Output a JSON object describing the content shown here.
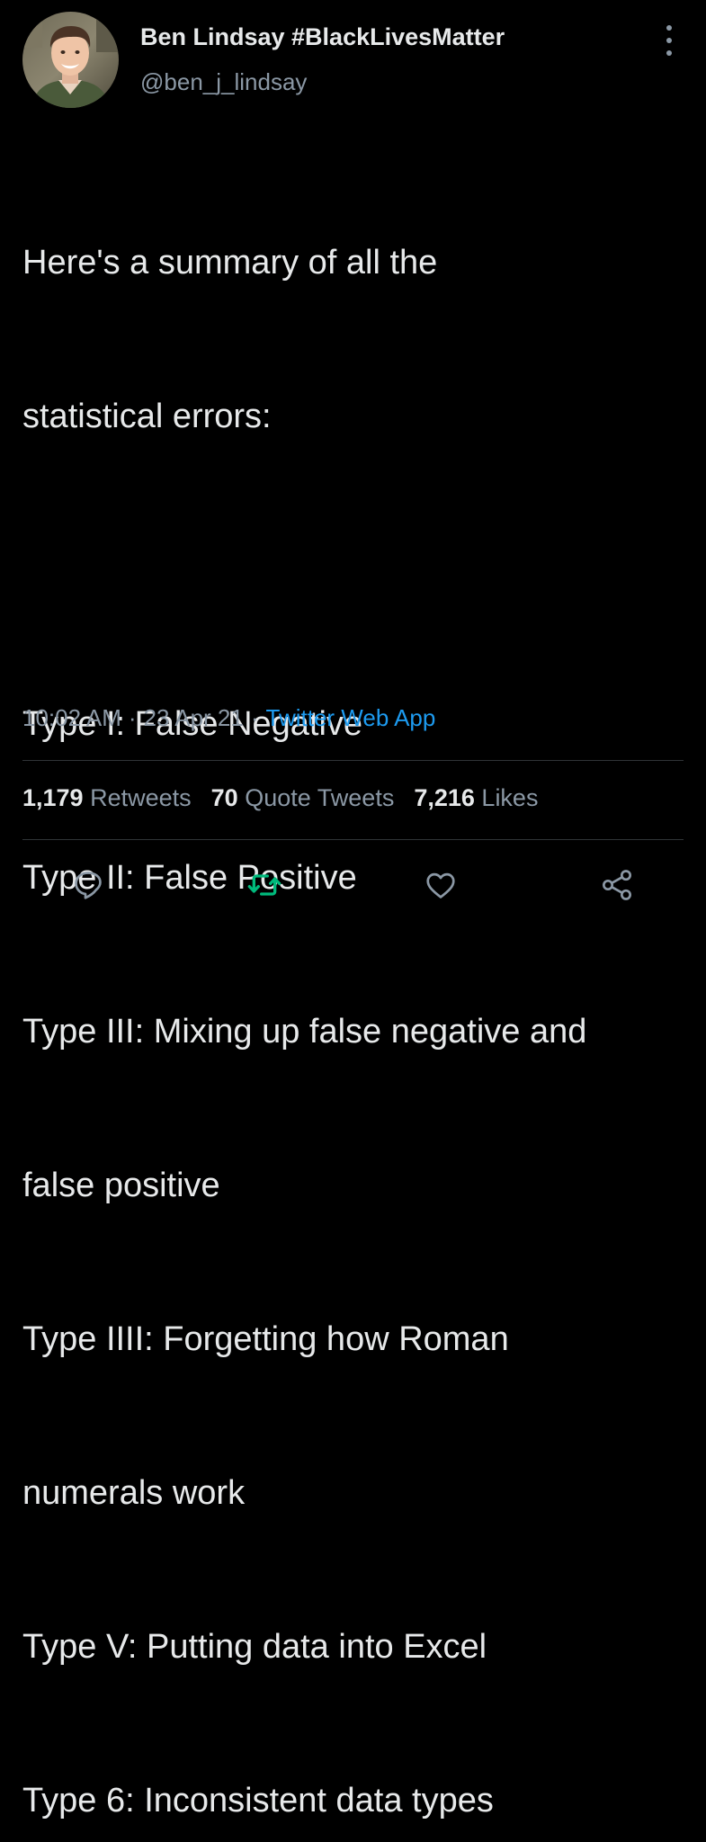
{
  "author": {
    "display_name": "Ben Lindsay #BlackLivesMatter",
    "handle": "@ben_j_lindsay"
  },
  "tweet": {
    "lines": [
      "Here's a summary of all the",
      "statistical errors:",
      "",
      "Type I: False Negative",
      "Type II: False Positive",
      "Type III: Mixing up false negative and",
      "false positive",
      "Type IIII: Forgetting how Roman",
      "numerals work",
      "Type V: Putting data into Excel",
      "Type 6: Inconsistent data types"
    ],
    "time": "10:02 AM",
    "date": "23 Apr 21",
    "separator": "·",
    "source": "Twitter Web App"
  },
  "stats": {
    "retweets_count": "1,179",
    "retweets_label": "Retweets",
    "quotes_count": "70",
    "quotes_label": "Quote Tweets",
    "likes_count": "7,216",
    "likes_label": "Likes"
  },
  "icons": {
    "reply": "reply-icon",
    "retweet": "retweet-icon",
    "like": "heart-icon",
    "share": "share-icon",
    "more": "more-icon"
  },
  "colors": {
    "background": "#000000",
    "text": "#e7e9ea",
    "secondary": "#8b98a5",
    "link": "#1d9bf0",
    "retweeted": "#00ba7c",
    "divider": "#2f3336"
  }
}
